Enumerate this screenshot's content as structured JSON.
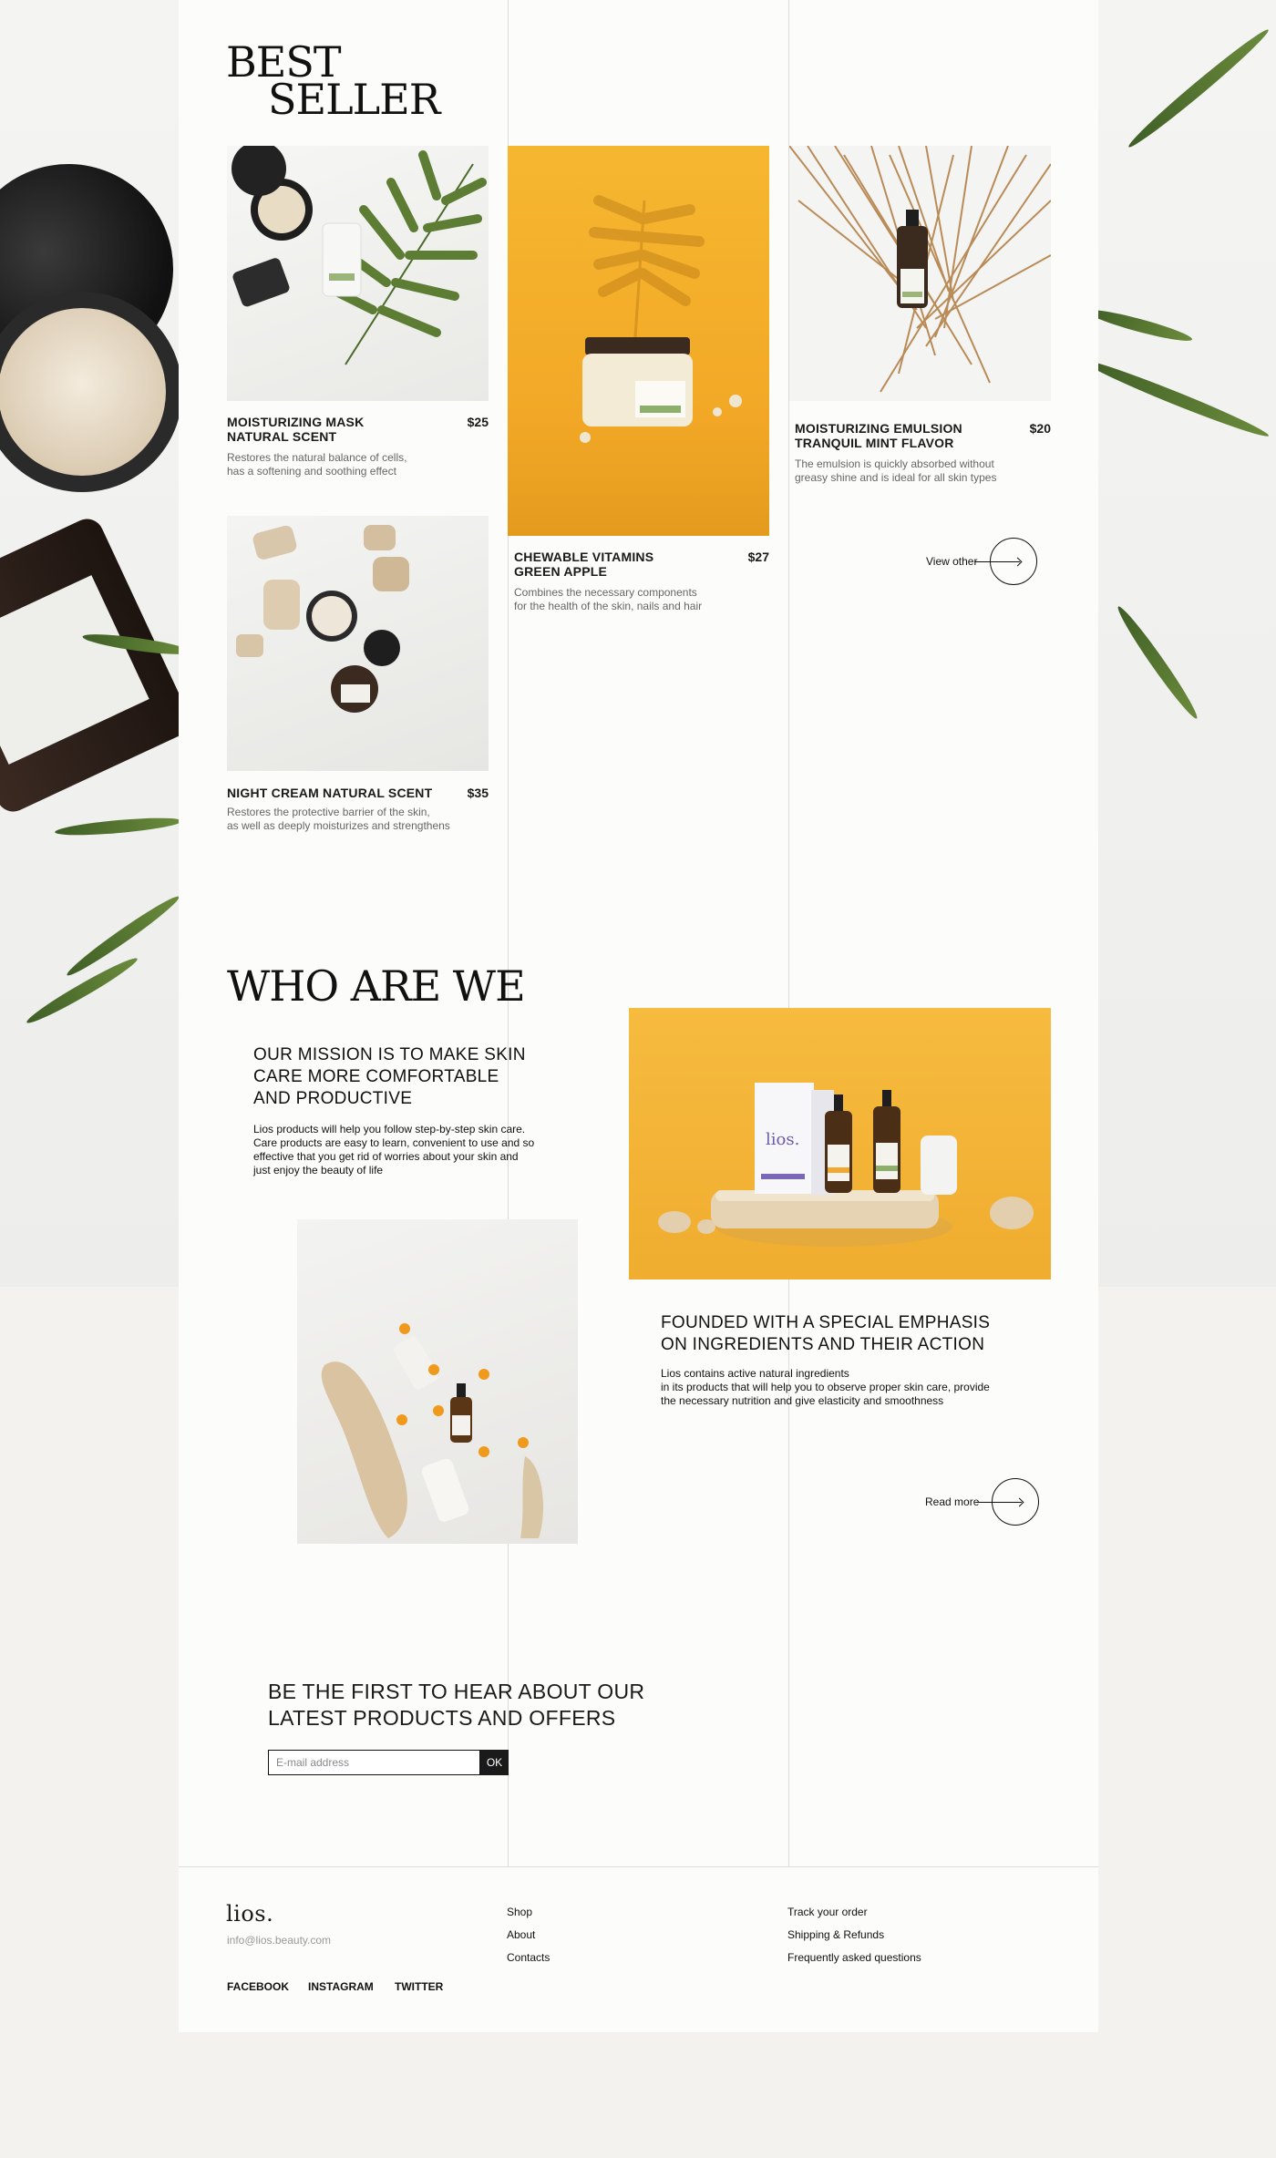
{
  "best_seller": {
    "title_line1": "BEST",
    "title_line2": "SELLER",
    "products": [
      {
        "name_line1": "MOISTURIZING MASK",
        "name_line2": "NATURAL SCENT",
        "price": "$25",
        "desc_line1": "Restores the natural balance of cells,",
        "desc_line2": "has a softening and soothing effect"
      },
      {
        "name_line1": "CHEWABLE VITAMINS",
        "name_line2": "GREEN APPLE",
        "price": "$27",
        "desc_line1": "Combines the necessary components",
        "desc_line2": "for the health of the skin, nails and hair"
      },
      {
        "name_line1": "MOISTURIZING EMULSION",
        "name_line2": "TRANQUIL MINT FLAVOR",
        "price": "$20",
        "desc_line1": "The emulsion is quickly absorbed without",
        "desc_line2": "greasy shine and is ideal for all skin types"
      },
      {
        "name_line1": "NIGHT CREAM NATURAL SCENT",
        "name_line2": "",
        "price": "$35",
        "desc_line1": "Restores the protective barrier of the skin,",
        "desc_line2": "as well as deeply moisturizes and strengthens"
      }
    ],
    "view_other": "View other"
  },
  "who": {
    "title": "WHO ARE WE",
    "mission_line1": "OUR MISSION IS TO MAKE SKIN",
    "mission_line2": "CARE MORE COMFORTABLE",
    "mission_line3": "AND PRODUCTIVE",
    "mission_text_line1": "Lios products will help you follow step-by-step skin care.",
    "mission_text_line2": "Care products are easy to learn, convenient to use and so",
    "mission_text_line3": "effective that you get rid of worries about your skin and",
    "mission_text_line4": "just enjoy the beauty of life",
    "founded_line1": "FOUNDED WITH A SPECIAL EMPHASIS",
    "founded_line2": "ON INGREDIENTS AND THEIR ACTION",
    "founded_text_line1": "Lios contains active natural ingredients",
    "founded_text_line2": "in its products that will help you to observe proper skin care, provide",
    "founded_text_line3": "the necessary nutrition and give elasticity and smoothness",
    "read_more": "Read more",
    "box_brand": "lios."
  },
  "newsletter": {
    "title_line1": "BE THE FIRST TO HEAR ABOUT OUR",
    "title_line2": "LATEST PRODUCTS AND OFFERS",
    "placeholder": "E-mail address",
    "button": "OK"
  },
  "footer": {
    "logo": "lios.",
    "email": "info@lios.beauty.com",
    "col1": [
      "Shop",
      "About",
      "Contacts"
    ],
    "col2": [
      "Track your order",
      "Shipping & Refunds",
      "Frequently asked questions"
    ],
    "social": [
      "FACEBOOK",
      "INSTAGRAM",
      "TWITTER"
    ]
  },
  "colors": {
    "accent_yellow": "#f3b536",
    "panel": "#fcfcfb",
    "page_bg": "#f3f2ee",
    "text": "#1a1a1a"
  }
}
